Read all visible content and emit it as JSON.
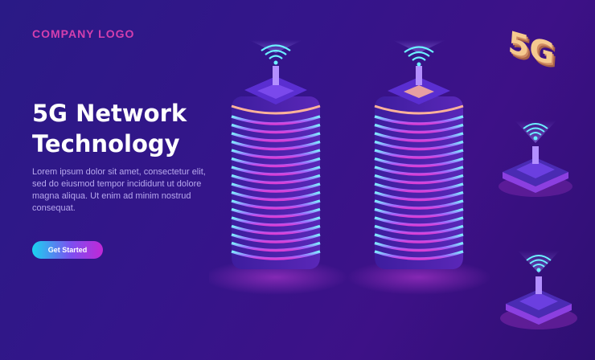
{
  "header": {
    "logo": "COMPANY LOGO"
  },
  "hero": {
    "title": "5G Network Technology",
    "body": "Lorem ipsum dolor sit amet, consectetur elit, sed do eiusmod tempor incididunt ut dolore magna aliqua. Ut enim ad minim nostrud consequat.",
    "cta_label": "Get Started"
  },
  "illustration": {
    "badge": "5G",
    "icons": [
      "wifi-icon",
      "server-tower",
      "router-device"
    ]
  },
  "colors": {
    "background": "#32148a",
    "logo": "#d43fae",
    "accent_cyan": "#1ad3f0",
    "accent_magenta": "#c128d6",
    "badge": "#f5c98f"
  }
}
